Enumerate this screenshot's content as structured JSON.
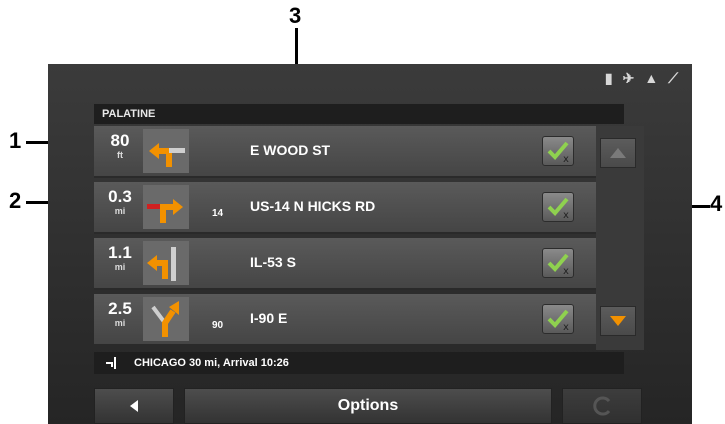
{
  "callouts": {
    "c1": "1",
    "c2": "2",
    "c3": "3",
    "c4": "4"
  },
  "status_icons": [
    "signal-icon",
    "satellite-icon",
    "alert-icon",
    "gps-icon"
  ],
  "header": {
    "city": "PALATINE"
  },
  "maneuvers": [
    {
      "distance": "80",
      "unit": "ft",
      "route_number": "",
      "street": "E WOOD ST",
      "turn": "left"
    },
    {
      "distance": "0.3",
      "unit": "mi",
      "route_number": "14",
      "street": "US-14 N HICKS RD",
      "turn": "right"
    },
    {
      "distance": "1.1",
      "unit": "mi",
      "route_number": "",
      "street": "IL-53 S",
      "turn": "left"
    },
    {
      "distance": "2.5",
      "unit": "mi",
      "route_number": "90",
      "street": "I-90 E",
      "turn": "fork-right"
    }
  ],
  "destination": {
    "text": "CHICAGO 30 mi, Arrival 10:26"
  },
  "buttons": {
    "options": "Options"
  },
  "colors": {
    "accent": "#f29100",
    "background": "#2e2e2e",
    "check": "#8fd14f",
    "red": "#d02020"
  }
}
